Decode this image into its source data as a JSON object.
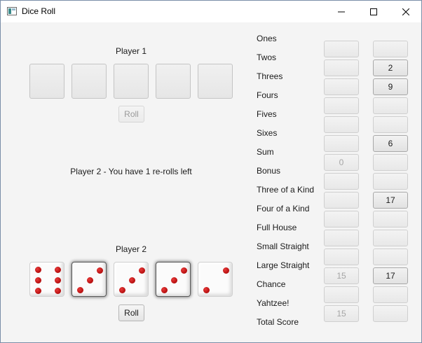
{
  "window": {
    "title": "Dice Roll",
    "controls": [
      "minimize",
      "maximize",
      "close"
    ]
  },
  "player1": {
    "name": "Player 1",
    "roll_label": "Roll",
    "dice": [
      null,
      null,
      null,
      null,
      null
    ]
  },
  "status": {
    "message": "Player 2 - You have 1 re-rolls left"
  },
  "player2": {
    "name": "Player 2",
    "roll_label": "Roll",
    "dice": [
      {
        "value": 6,
        "held": false
      },
      {
        "value": 3,
        "held": true
      },
      {
        "value": 3,
        "held": false
      },
      {
        "value": 3,
        "held": true
      },
      {
        "value": 2,
        "held": false
      }
    ]
  },
  "colors": {
    "pip": "#c81616",
    "background": "#f4f4f4"
  },
  "scorecard": {
    "categories": [
      {
        "label": "Ones",
        "p1": "",
        "p2": ""
      },
      {
        "label": "Twos",
        "p1": "",
        "p2": "2"
      },
      {
        "label": "Threes",
        "p1": "",
        "p2": "9"
      },
      {
        "label": "Fours",
        "p1": "",
        "p2": ""
      },
      {
        "label": "Fives",
        "p1": "",
        "p2": ""
      },
      {
        "label": "Sixes",
        "p1": "",
        "p2": "6"
      },
      {
        "label": "Sum",
        "p1": "0",
        "p2": ""
      },
      {
        "label": "Bonus",
        "p1": "",
        "p2": ""
      },
      {
        "label": "Three of a Kind",
        "p1": "",
        "p2": "17"
      },
      {
        "label": "Four of a Kind",
        "p1": "",
        "p2": ""
      },
      {
        "label": "Full House",
        "p1": "",
        "p2": ""
      },
      {
        "label": "Small Straight",
        "p1": "",
        "p2": ""
      },
      {
        "label": "Large Straight",
        "p1": "15",
        "p2": "17"
      },
      {
        "label": "Chance",
        "p1": "",
        "p2": ""
      },
      {
        "label": "Yahtzee!",
        "p1": "15",
        "p2": ""
      },
      {
        "label": "Total Score",
        "p1": "",
        "p2": ""
      }
    ]
  }
}
